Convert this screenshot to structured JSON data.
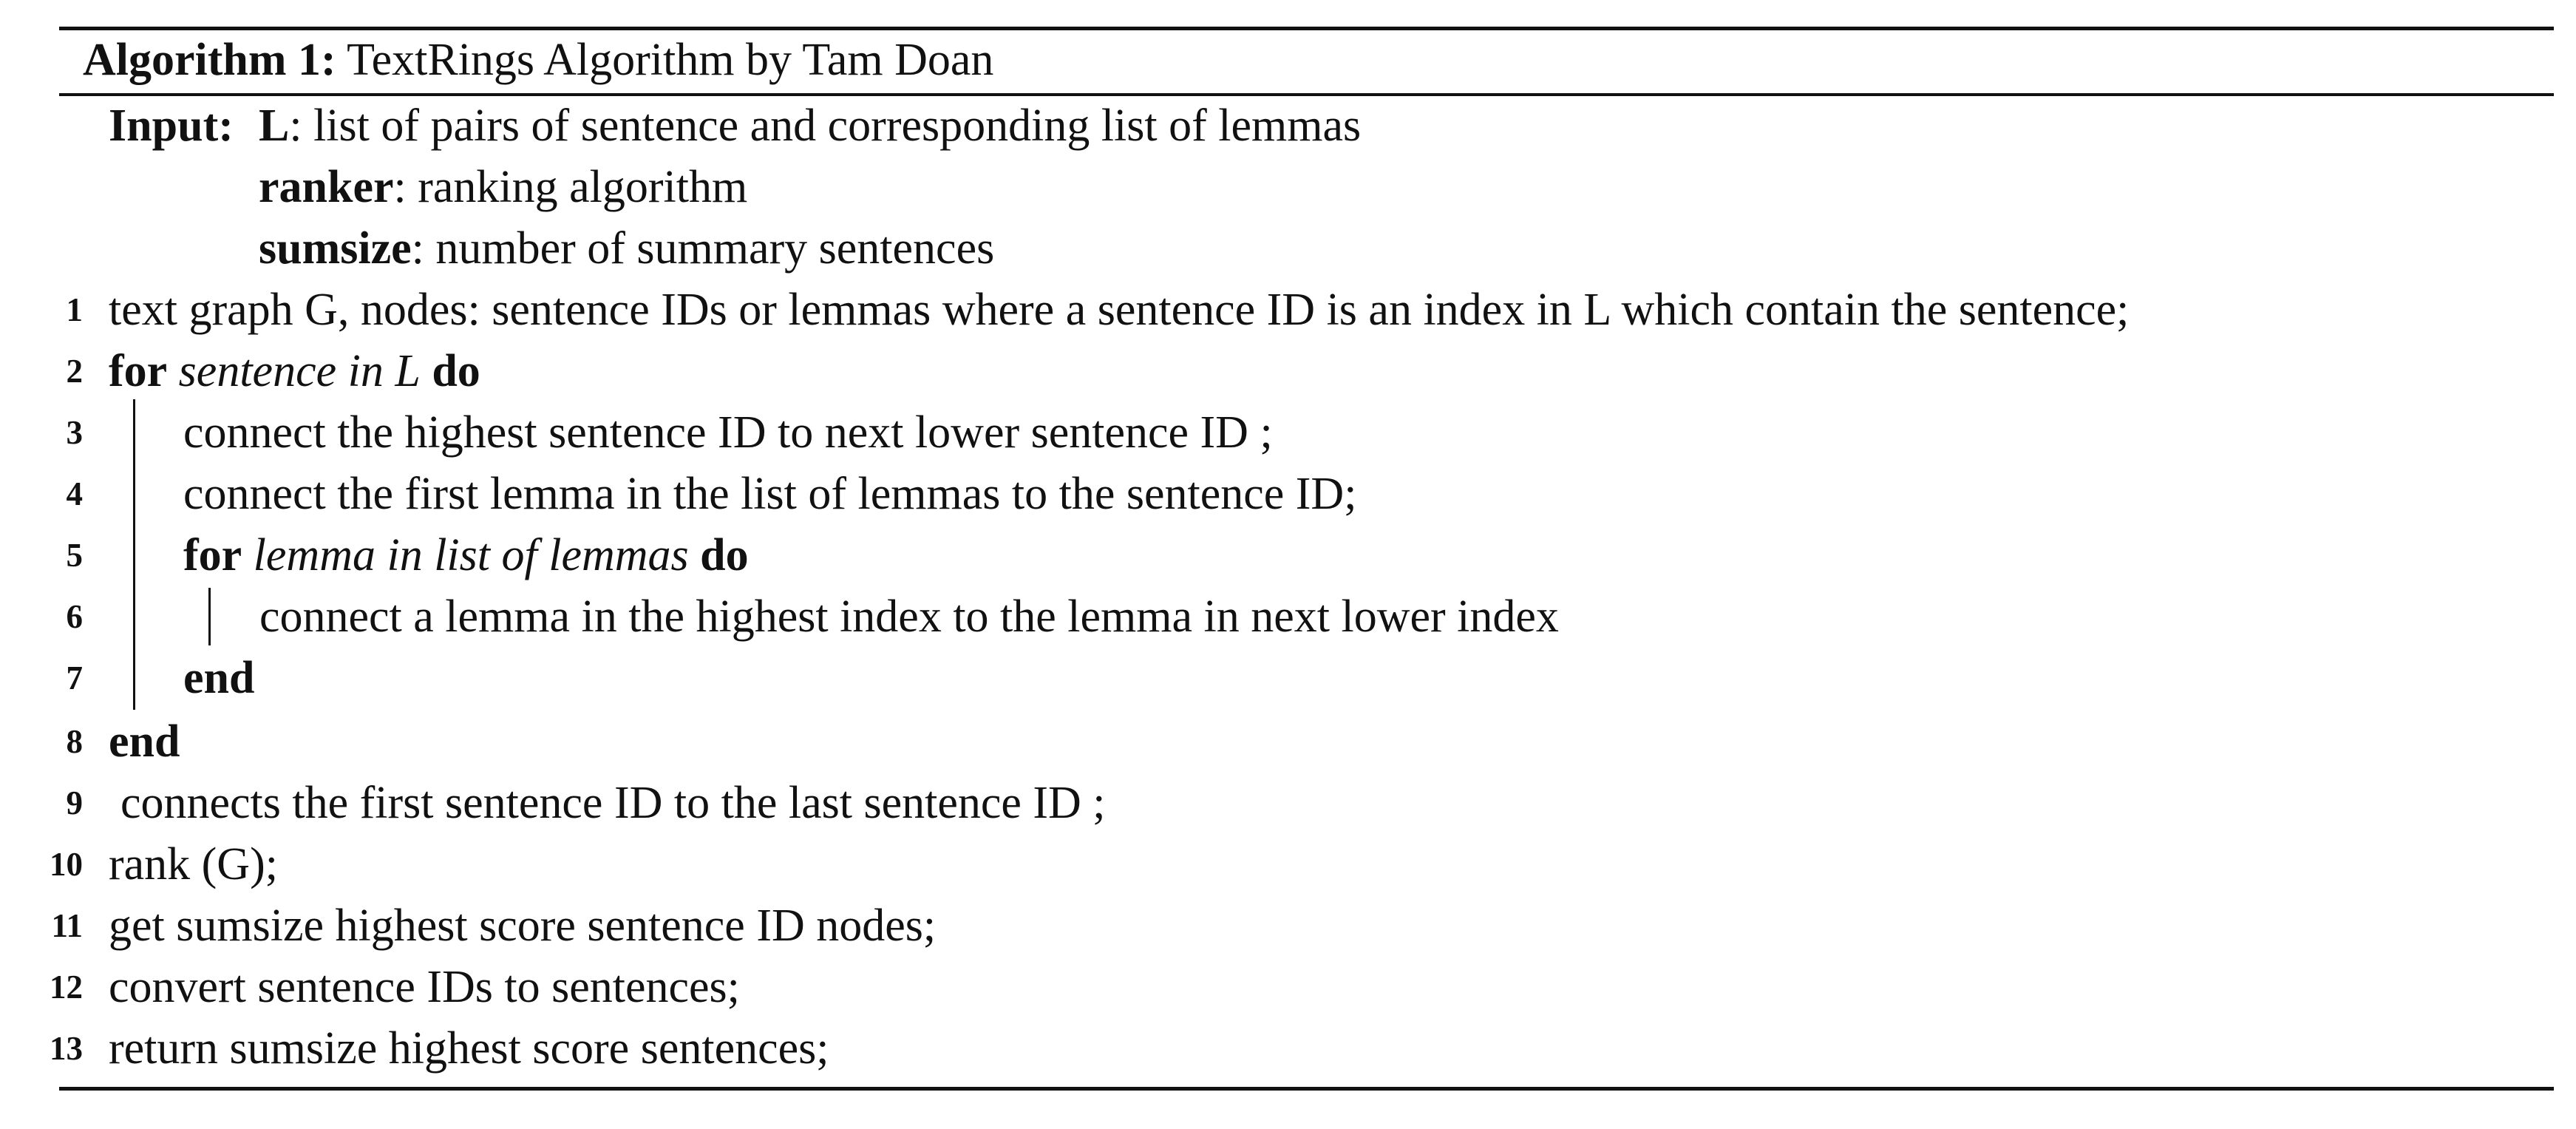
{
  "algorithm": {
    "label": "Algorithm 1:",
    "title": "TextRings Algorithm by Tam Doan"
  },
  "input": {
    "keyword": "Input:",
    "params": [
      {
        "name": "L",
        "desc": ": list of pairs of sentence and corresponding list of lemmas"
      },
      {
        "name": "ranker",
        "desc": ": ranking algorithm"
      },
      {
        "name": "sumsize",
        "desc": ": number of summary sentences"
      }
    ]
  },
  "lines": [
    {
      "n": "1",
      "text": "text graph G, nodes: sentence IDs or lemmas where a sentence ID is an index in L which contain the sentence;"
    },
    {
      "n": "2",
      "kw_for": "for",
      "cond": "sentence in L",
      "kw_do": "do"
    },
    {
      "n": "3",
      "text": "connect the highest sentence ID to next lower sentence ID ;"
    },
    {
      "n": "4",
      "text": "connect the first lemma in the list of lemmas to the sentence ID;"
    },
    {
      "n": "5",
      "kw_for": "for",
      "cond": "lemma in list of lemmas",
      "kw_do": "do"
    },
    {
      "n": "6",
      "text": "connect a lemma in the highest index to the lemma in next lower index"
    },
    {
      "n": "7",
      "kw": "end"
    },
    {
      "n": "8",
      "kw": "end"
    },
    {
      "n": "9",
      "text": "connects the first sentence ID to the last sentence ID ;"
    },
    {
      "n": "10",
      "text": "rank (G);"
    },
    {
      "n": "11",
      "text": "get sumsize highest score sentence ID nodes;"
    },
    {
      "n": "12",
      "text": "convert sentence IDs to sentences;"
    },
    {
      "n": "13",
      "text": "return sumsize highest score sentences;"
    }
  ]
}
